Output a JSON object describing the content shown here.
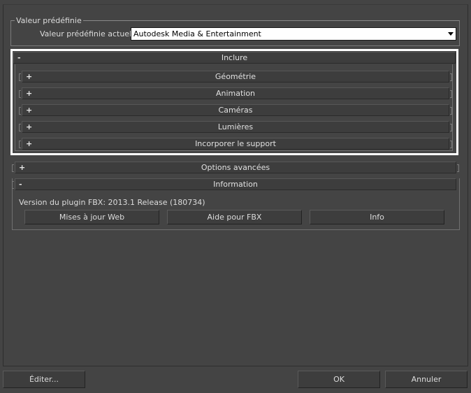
{
  "preset": {
    "group_label": "Valeur prédéfinie",
    "current_label": "Valeur prédéfinie actuelle:",
    "current_value": "Autodesk Media & Entertainment"
  },
  "include": {
    "sign": "-",
    "title": "Inclure",
    "items": [
      {
        "sign": "+",
        "label": "Géométrie"
      },
      {
        "sign": "+",
        "label": "Animation"
      },
      {
        "sign": "+",
        "label": "Caméras"
      },
      {
        "sign": "+",
        "label": "Lumières"
      },
      {
        "sign": "+",
        "label": "Incorporer le support"
      }
    ]
  },
  "advanced": {
    "sign": "+",
    "title": "Options avancées"
  },
  "information": {
    "sign": "-",
    "title": "Information",
    "version_text": "Version du plugin FBX: 2013.1 Release (180734)",
    "buttons": {
      "web_updates": "Mises à jour Web",
      "fbx_help": "Aide pour FBX",
      "info": "Info"
    }
  },
  "footer": {
    "edit": "Éditer...",
    "ok": "OK",
    "cancel": "Annuler"
  },
  "colors": {
    "background": "#444444",
    "highlight_frame": "#ffffff",
    "dropdown_bg": "#ffffff"
  }
}
